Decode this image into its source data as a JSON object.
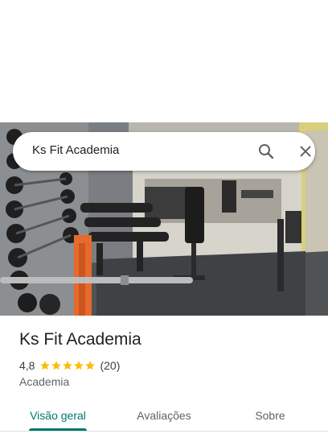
{
  "search": {
    "query": "Ks Fit Academia",
    "search_icon": "search-icon",
    "close_icon": "close-icon"
  },
  "place": {
    "name": "Ks Fit Academia",
    "rating": "4,8",
    "stars": 5,
    "review_count": "(20)",
    "category": "Academia"
  },
  "tabs": [
    {
      "label": "Visão geral",
      "active": true
    },
    {
      "label": "Avaliações",
      "active": false
    },
    {
      "label": "Sobre",
      "active": false
    }
  ],
  "colors": {
    "accent": "#00796b",
    "star": "#fbbc04",
    "text": "#202124",
    "secondary": "#5f6368"
  }
}
